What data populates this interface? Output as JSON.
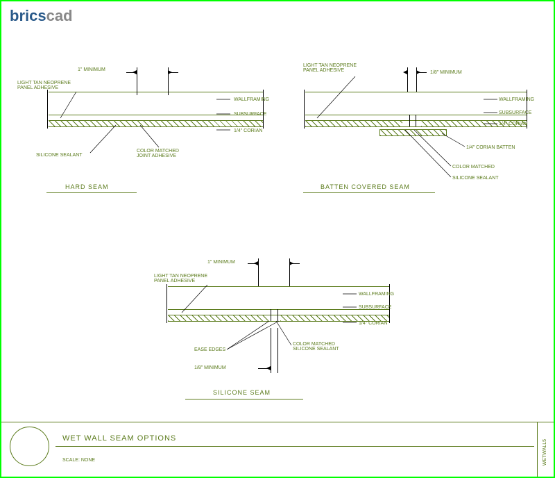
{
  "logo": {
    "part1": "brics",
    "part2": "cad"
  },
  "detail1": {
    "title": "HARD SEAM",
    "labels": {
      "minimum": "1\" MINIMUM",
      "adhesive": "LIGHT TAN NEOPRENE PANEL ADHESIVE",
      "wallframing": "WALLFRAMING",
      "subsurface": "SUBSURFACE",
      "corian": "1/4\" CORIAN",
      "sealant": "SILICONE SEALANT",
      "joint": "COLOR MATCHED JOINT ADHESIVE"
    }
  },
  "detail2": {
    "title": "BATTEN COVERED SEAM",
    "labels": {
      "minimum": "1/8\" MINIMUM",
      "adhesive": "LIGHT TAN NEOPRENE PANEL ADHESIVE",
      "wallframing": "WALLFRAMING",
      "subsurface": "SUBSURFACE",
      "corian": "1/4\" CORIAN",
      "batten": "1/4\" CORIAN BATTEN",
      "matched": "COLOR MATCHED",
      "sealant": "SILICONE SEALANT"
    }
  },
  "detail3": {
    "title": "SILICONE SEAM",
    "labels": {
      "minimum": "1\" MINIMUM",
      "adhesive": "LIGHT TAN NEOPRENE PANEL ADHESIVE",
      "wallframing": "WALLFRAMING",
      "subsurface": "SUBSURFACE",
      "corian": "1/4\" CORIAN",
      "ease": "EASE EDGES",
      "eighth": "1/8\" MINIMUM",
      "sealant": "COLOR MATCHED SILICONE SEALANT"
    }
  },
  "footer": {
    "title": "WET WALL SEAM OPTIONS",
    "scale": "SCALE: NONE",
    "side": "WETWALL5"
  }
}
